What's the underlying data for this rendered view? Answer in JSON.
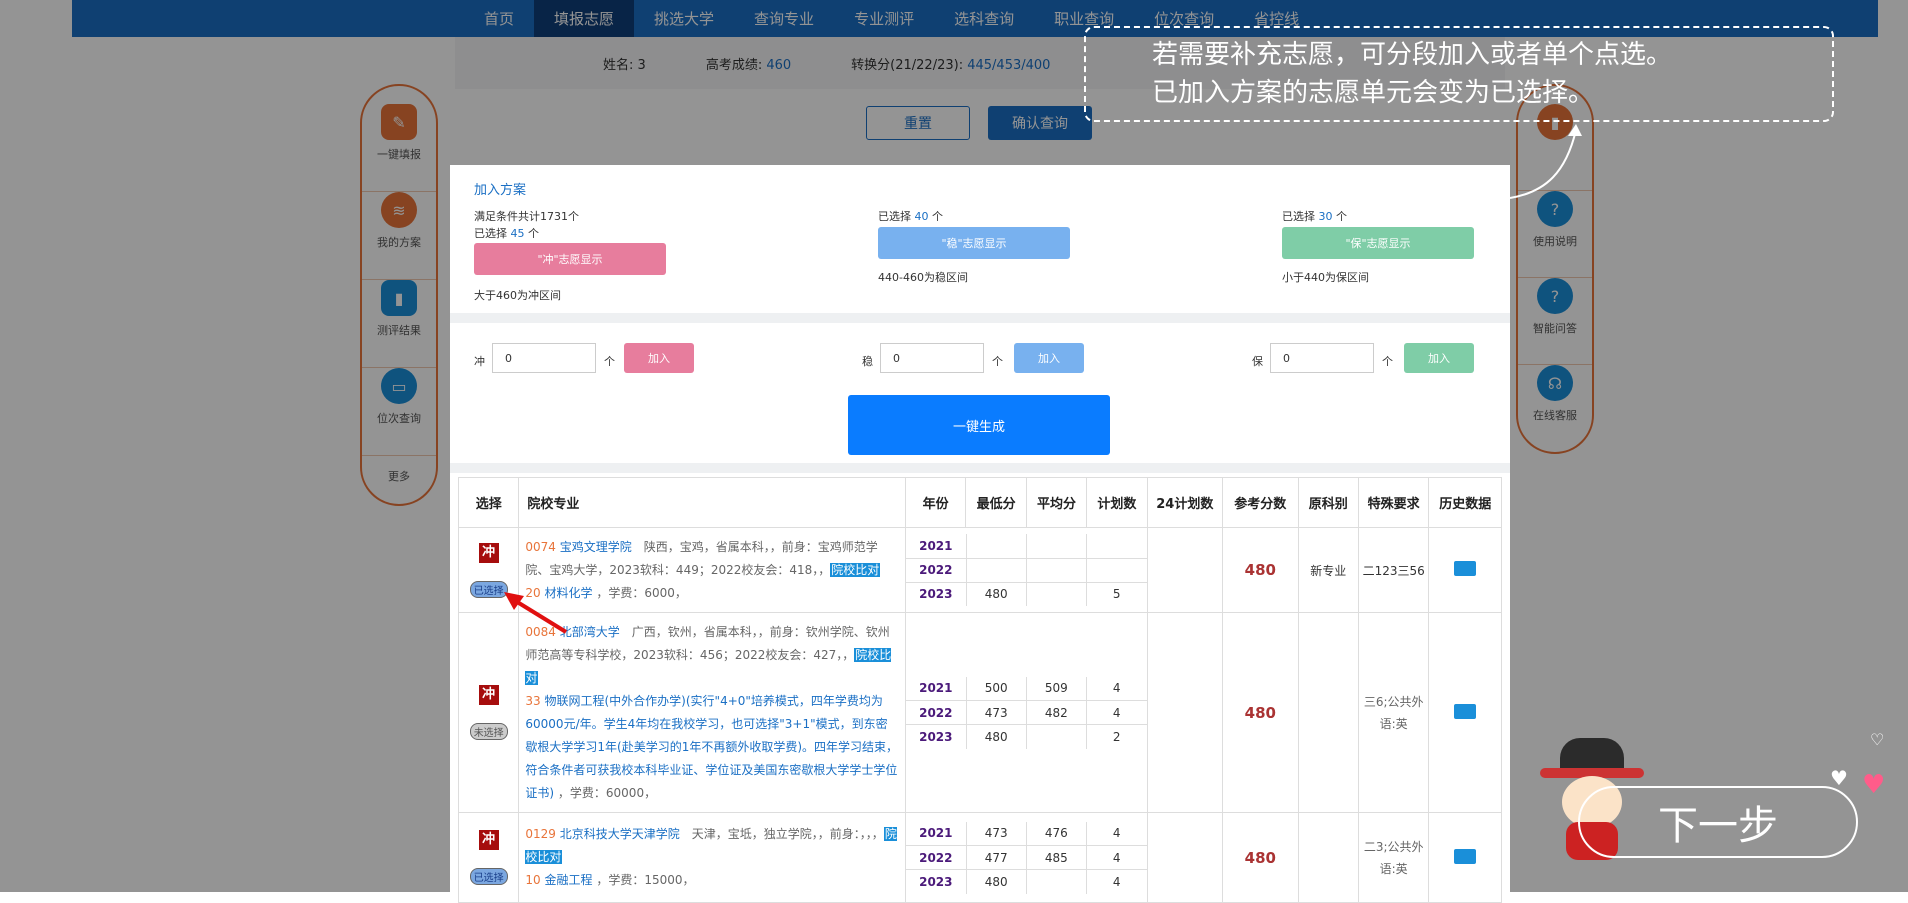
{
  "nav": {
    "items": [
      "首页",
      "填报志愿",
      "挑选大学",
      "查询专业",
      "专业测评",
      "选科查询",
      "职业查询",
      "位次查询",
      "省控线"
    ]
  },
  "info": {
    "name_label": "姓名:",
    "name_value": "3",
    "score_label": "高考成绩:",
    "score_value": "460",
    "conv_label": "转换分(21/22/23):",
    "conv_value": "445/453/400"
  },
  "buttons": {
    "reset": "重置",
    "confirm": "确认查询"
  },
  "sidebar_left": [
    "一键填报",
    "我的方案",
    "测评结果",
    "位次查询",
    "更多"
  ],
  "sidebar_right": [
    "",
    "使用说明",
    "智能问答",
    "在线客服"
  ],
  "modal": {
    "title": "加入方案",
    "total": "满足条件共计1731个",
    "cols": [
      {
        "selected_prefix": "已选择",
        "selected": "45",
        "unit": "个",
        "button": "\"冲\"志愿显示",
        "note": "大于460为冲区间",
        "color": "#e77d9d"
      },
      {
        "selected_prefix": "已选择",
        "selected": "40",
        "unit": "个",
        "button": "\"稳\"志愿显示",
        "note": "440-460为稳区间",
        "color": "#78b1ef"
      },
      {
        "selected_prefix": "已选择",
        "selected": "30",
        "unit": "个",
        "button": "\"保\"志愿显示",
        "note": "小于440为保区间",
        "color": "#7fcda7"
      }
    ],
    "inputs": [
      {
        "label": "冲",
        "value": "0",
        "unit": "个",
        "add": "加入"
      },
      {
        "label": "稳",
        "value": "0",
        "unit": "个",
        "add": "加入"
      },
      {
        "label": "保",
        "value": "0",
        "unit": "个",
        "add": "加入"
      }
    ],
    "generate": "一键生成"
  },
  "table": {
    "headers": [
      "选择",
      "院校专业",
      "年份",
      "最低分",
      "平均分",
      "计划数",
      "24计划数",
      "参考分数",
      "原科别",
      "特殊要求",
      "历史数据"
    ],
    "rows": [
      {
        "tag": "冲",
        "status": "已选择",
        "code": "0074",
        "name": "宝鸡文理学院",
        "desc": "陕西，宝鸡，省属本科，，前身：宝鸡师范学院、宝鸡大学，2023软科：449；2022校友会：418，，",
        "compare": "院校比对",
        "major_code": "20",
        "major": "材料化学",
        "fee": "，学费：6000，",
        "years": [
          [
            "2021",
            "",
            "",
            ""
          ],
          [
            "2022",
            "",
            "",
            ""
          ],
          [
            "2023",
            "480",
            "",
            "5"
          ]
        ],
        "ref": "480",
        "subject": "新专业",
        "special": "二123三56"
      },
      {
        "tag": "冲",
        "status": "未选择",
        "code": "0084",
        "name": "北部湾大学",
        "desc": "广西，钦州，省属本科，，前身：钦州学院、钦州师范高等专科学校，2023软科：456；2022校友会：427，，",
        "compare": "院校比对",
        "major_code": "33",
        "major": "物联网工程(中外合作办学)(实行\"4+0\"培养模式，四年学费均为60000元/年。学生4年均在我校学习，也可选择\"3+1\"模式，到东密歇根大学学习1年(赴美学习的1年不再额外收取学费)。四年学习结束，符合条件者可获我校本科毕业证、学位证及美国东密歇根大学学士学位证书)",
        "fee": "，学费：60000，",
        "years": [
          [
            "2021",
            "500",
            "509",
            "4"
          ],
          [
            "2022",
            "473",
            "482",
            "4"
          ],
          [
            "2023",
            "480",
            "",
            "2"
          ]
        ],
        "ref": "480",
        "subject": "",
        "special": "三6;公共外语:英"
      },
      {
        "tag": "冲",
        "status": "已选择",
        "code": "0129",
        "name": "北京科技大学天津学院",
        "desc": "天津，宝坻，独立学院，，前身：，，，",
        "compare": "院校比对",
        "major_code": "10",
        "major": "金融工程",
        "fee": "，学费：15000，",
        "years": [
          [
            "2021",
            "473",
            "476",
            "4"
          ],
          [
            "2022",
            "477",
            "485",
            "4"
          ],
          [
            "2023",
            "480",
            "",
            "4"
          ]
        ],
        "ref": "480",
        "subject": "",
        "special": "二3;公共外语:英"
      }
    ]
  },
  "tip": {
    "line1": "若需要补充志愿，可分段加入或者单个点选。",
    "line2": "已加入方案的志愿单元会变为已选择。"
  },
  "next": "下一步"
}
